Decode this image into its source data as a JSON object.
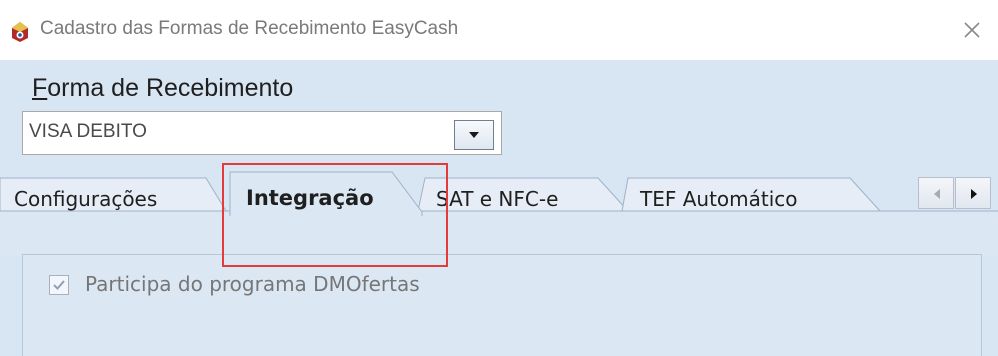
{
  "window": {
    "title": "Cadastro das Formas de Recebimento EasyCash",
    "app_icon": "app-icon",
    "close_icon": "close-icon"
  },
  "form": {
    "label_first": "F",
    "label_rest": "orma de Recebimento",
    "combo_value": "VISA DEBITO",
    "dropdown_icon": "chevron-down-icon"
  },
  "tabs": [
    {
      "label": "Configurações",
      "active": false
    },
    {
      "label": "Integração",
      "active": true
    },
    {
      "label": "SAT e NFC-e",
      "active": false
    },
    {
      "label": "TEF Automático",
      "active": false
    }
  ],
  "tab_scroll": {
    "left_icon": "chevron-left-icon",
    "right_icon": "chevron-right-icon"
  },
  "integration": {
    "checkbox_label": "Participa do programa DMOfertas",
    "checked": true
  },
  "colors": {
    "client_bg": "#d8e5f3",
    "highlight": "#e33b3b"
  }
}
